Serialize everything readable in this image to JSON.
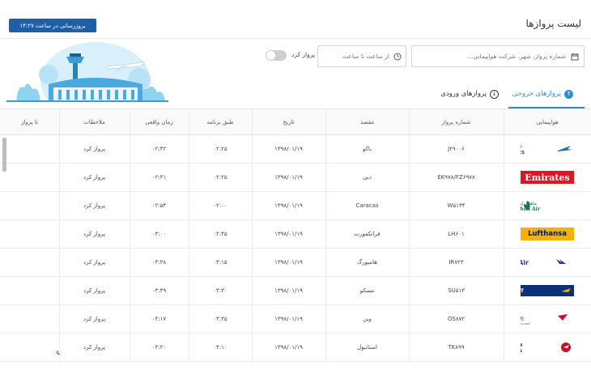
{
  "header": {
    "title": "لیست پروازها",
    "update_button": "بروزرسانی در ساعت ۱۴:۲۷"
  },
  "filters": {
    "search_placeholder": "شماره پرواز، شهر، شرکت هواپیمایی...",
    "time_placeholder": "از ساعت تا ساعت",
    "toggle_label": "پرواز کرد",
    "toggle_on": false
  },
  "tabs": {
    "outgoing": "پروازهای خروجی",
    "incoming": "پروازهای ورودی",
    "active": "outgoing"
  },
  "table": {
    "headers": {
      "airline": "هواپیمایی",
      "flight_no": "شماره پرواز",
      "destination": "مقصد",
      "date": "تاریخ",
      "scheduled": "طبق برنامه",
      "actual": "زمان واقعی",
      "remarks": "ملاحظات",
      "until": "تا پرواز"
    },
    "rows": [
      {
        "airline": "AZERBAIJAN AIRLINES",
        "airline_logo": "azerbaijan-airlines-logo",
        "flight_no": "J۲۹۰۰۶",
        "destination": "باکو",
        "date": "۱۳۹۸/۰۱/۱۹",
        "scheduled": "۰۲:۲۵",
        "actual": "۰۲:۳۲",
        "remarks": "پرواز کرد"
      },
      {
        "airline": "Emirates",
        "airline_logo": "emirates-logo",
        "flight_no": "EK۹۷۸/FZ۶۹۷۸",
        "destination": "دبی",
        "date": "۱۳۹۸/۰۱/۱۹",
        "scheduled": "۰۲:۲۵",
        "actual": "۰۲:۴۱",
        "remarks": "پرواز کرد"
      },
      {
        "airline": "Mahan Air",
        "airline_logo": "mahan-air-logo",
        "flight_no": "W۵۱۳۴",
        "destination": "Caracas",
        "date": "۱۳۹۸/۰۱/۱۹",
        "scheduled": "۰۲:۰۰",
        "actual": "۰۲:۵۴",
        "remarks": "پرواز کرد"
      },
      {
        "airline": "Lufthansa",
        "airline_logo": "lufthansa-logo",
        "flight_no": "LH۶۰۱",
        "destination": "فرانکفورت",
        "date": "۱۳۹۸/۰۱/۱۹",
        "scheduled": "۰۲:۴۵",
        "actual": "۰۳:۰۰",
        "remarks": "پرواز کرد"
      },
      {
        "airline": "IranAir",
        "airline_logo": "iranair-logo",
        "flight_no": "IR۷۲۳",
        "destination": "هامبورگ",
        "date": "۱۳۹۸/۰۱/۱۹",
        "scheduled": "۰۳:۱۵",
        "actual": "۰۳:۳۸",
        "remarks": "پرواز کرد"
      },
      {
        "airline": "AEROFLOT",
        "airline_logo": "aeroflot-logo",
        "flight_no": "SU۵۱۳",
        "destination": "مسکو",
        "date": "۱۳۹۸/۰۱/۱۹",
        "scheduled": "۰۳:۳۰",
        "actual": "۰۳:۴۹",
        "remarks": "پرواز کرد"
      },
      {
        "airline": "Austrian",
        "airline_logo": "austrian-logo",
        "flight_no": "OS۸۷۲",
        "destination": "وین",
        "date": "۱۳۹۸/۰۱/۱۹",
        "scheduled": "۰۳:۴۵",
        "actual": "۰۴:۱۷",
        "remarks": "پرواز کرد"
      },
      {
        "airline": "TURKISH AIRLINES",
        "airline_logo": "turkish-airlines-logo",
        "flight_no": "TK۸۹۹",
        "destination": "استانبول",
        "date": "۱۳۹۸/۰۱/۱۹",
        "scheduled": "۰۴:۱۰",
        "actual": "۰۴:۲۰",
        "remarks": "پرواز کرد"
      }
    ]
  },
  "watermark": "الی گشت",
  "colors": {
    "accent": "#2a8fd8",
    "update_button": "#1f5fa8",
    "emirates": "#d71a21",
    "lufthansa": "#f9b000",
    "watermark": "#e8632a"
  }
}
